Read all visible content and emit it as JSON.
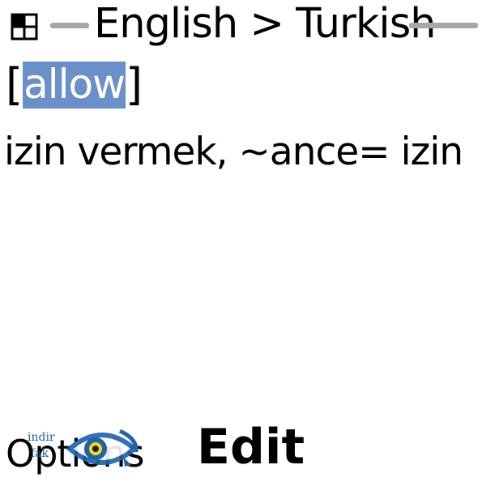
{
  "titlebar": {
    "title": "English > Turkish",
    "icon": "dictionary-app-icon"
  },
  "entry": {
    "open_bracket": "[",
    "query": "allow",
    "close_bracket": "]"
  },
  "result": {
    "translation": "izin vermek, ~ance= izin"
  },
  "softkeys": {
    "left": "Options",
    "center": "Edit"
  },
  "watermark": {
    "line1": "indir",
    "line2": "fak",
    "icon": "eye-logo-icon"
  },
  "colors": {
    "selection": "#6b8fc8",
    "title_line": "#a7a7a7",
    "watermark": "#1e62b0"
  }
}
